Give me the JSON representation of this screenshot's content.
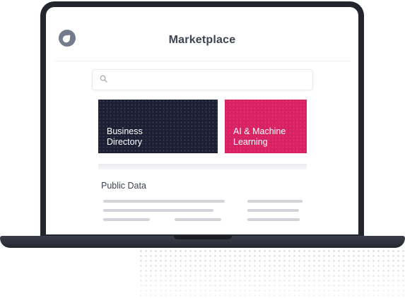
{
  "app": {
    "title": "Marketplace",
    "logo_icon": "drop-logo-icon"
  },
  "search": {
    "icon": "search-icon",
    "placeholder": ""
  },
  "tiles": [
    {
      "line1": "Business",
      "line2": "Directory",
      "color": "#1d2034"
    },
    {
      "line1": "AI & Machine",
      "line2": "Learning",
      "color": "#d92262"
    }
  ],
  "section": {
    "title": "Public Data"
  },
  "colors": {
    "laptop_frame": "#23252d",
    "accent_pink": "#d92262",
    "navy": "#1d2034",
    "text": "#3d4352"
  }
}
